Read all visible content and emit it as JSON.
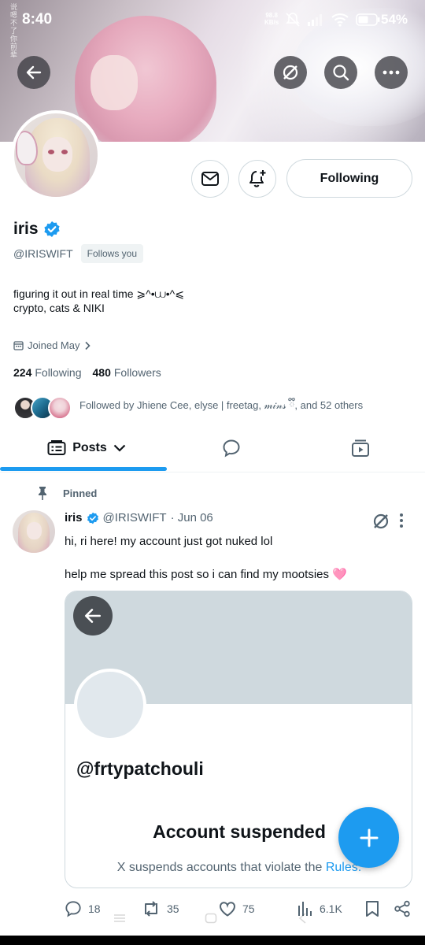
{
  "status_bar": {
    "time": "8:40",
    "net_speed": "98.8",
    "net_unit": "KB/s",
    "battery": "54%"
  },
  "banner": {
    "vertical_text": "说嗯不了你前辈"
  },
  "profile": {
    "name": "iris",
    "handle": "@IRISWIFT",
    "follows_you": "Follows you",
    "bio_line1": "figuring it out in real time ⩾^•⩊•^⩽",
    "bio_line2": "crypto, cats & NIKI",
    "joined": "Joined May",
    "following_count": "224",
    "following_label": "Following",
    "followers_count": "480",
    "followers_label": "Followers",
    "followed_by": "Followed by Jhiene Cee, elyse | freetag, 𝓂𝒾𝓃𝓈 ྀི, and 52 others",
    "following_button": "Following"
  },
  "tabs": {
    "posts": "Posts"
  },
  "post": {
    "pinned_label": "Pinned",
    "author_name": "iris",
    "author_handle": "@IRISWIFT",
    "date": "· Jun 06",
    "text1": "hi, ri here! my account just got nuked lol",
    "text2": "help me spread this post so i can find my mootsies 🩷",
    "card": {
      "handle": "@frtypatchouli",
      "title": "Account suspended",
      "sub_text": "X suspends accounts that violate the ",
      "rules_link": "Rules."
    },
    "replies": "18",
    "reposts": "35",
    "likes": "75",
    "views": "6.1K"
  },
  "colors": {
    "accent": "#1d9bf0",
    "text_primary": "#0f1419",
    "text_secondary": "#536471",
    "border": "#cfd9de"
  }
}
